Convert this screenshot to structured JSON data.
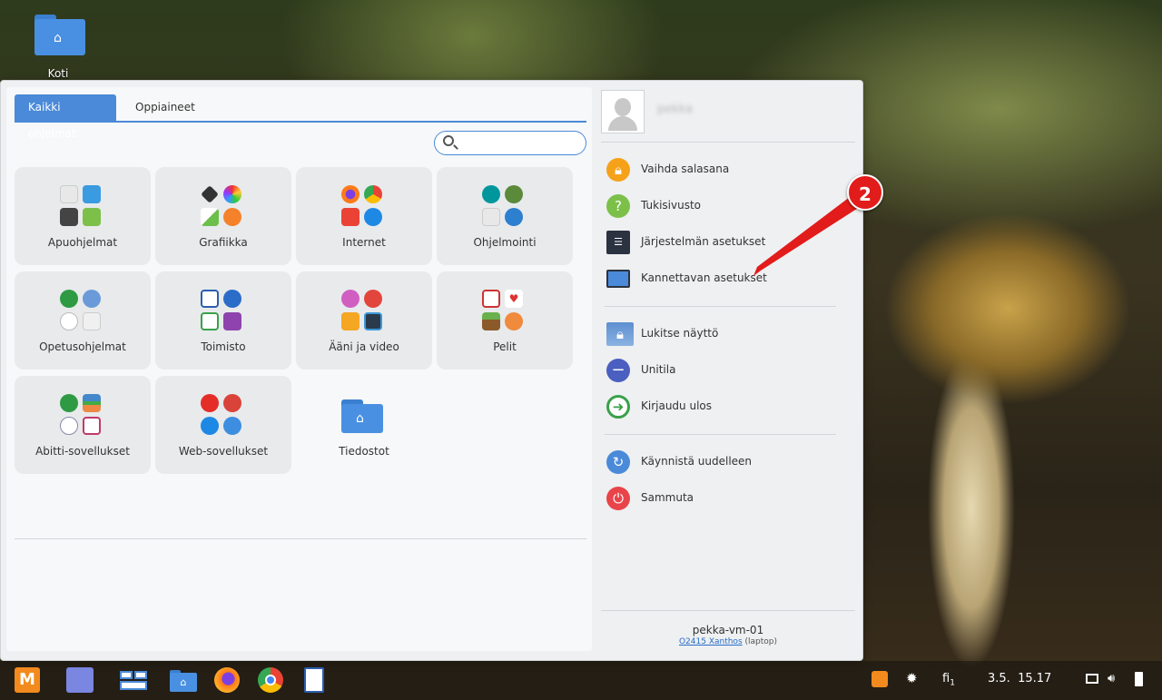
{
  "desktop": {
    "home_label": "Koti"
  },
  "menu": {
    "tabs": [
      {
        "label": "Kaikki ohjelmat"
      },
      {
        "label": "Oppiaineet"
      }
    ],
    "search": {
      "value": "",
      "placeholder": ""
    },
    "categories": [
      {
        "label": "Apuohjelmat"
      },
      {
        "label": "Grafiikka"
      },
      {
        "label": "Internet"
      },
      {
        "label": "Ohjelmointi"
      },
      {
        "label": "Opetusohjelmat"
      },
      {
        "label": "Toimisto"
      },
      {
        "label": "Ääni ja video"
      },
      {
        "label": "Pelit"
      },
      {
        "label": "Abitti-sovellukset"
      },
      {
        "label": "Web-sovellukset"
      },
      {
        "label": "Tiedostot"
      }
    ]
  },
  "user": {
    "name": "pekka"
  },
  "actions": [
    {
      "label": "Vaihda salasana"
    },
    {
      "label": "Tukisivusto"
    },
    {
      "label": "Järjestelmän asetukset"
    },
    {
      "label": "Kannettavan asetukset"
    },
    {
      "label": "Lukitse näyttö"
    },
    {
      "label": "Unitila"
    },
    {
      "label": "Kirjaudu ulos"
    },
    {
      "label": "Käynnistä uudelleen"
    },
    {
      "label": "Sammuta"
    }
  ],
  "footer": {
    "hostname": "pekka-vm-01",
    "machine_link": "O2415 Xanthos",
    "machine_type": "(laptop)"
  },
  "annotation": {
    "number": "2"
  },
  "taskbar": {
    "keyboard_layout": "fi",
    "keyboard_sub": "1",
    "clock": "3.5.  15.17"
  }
}
